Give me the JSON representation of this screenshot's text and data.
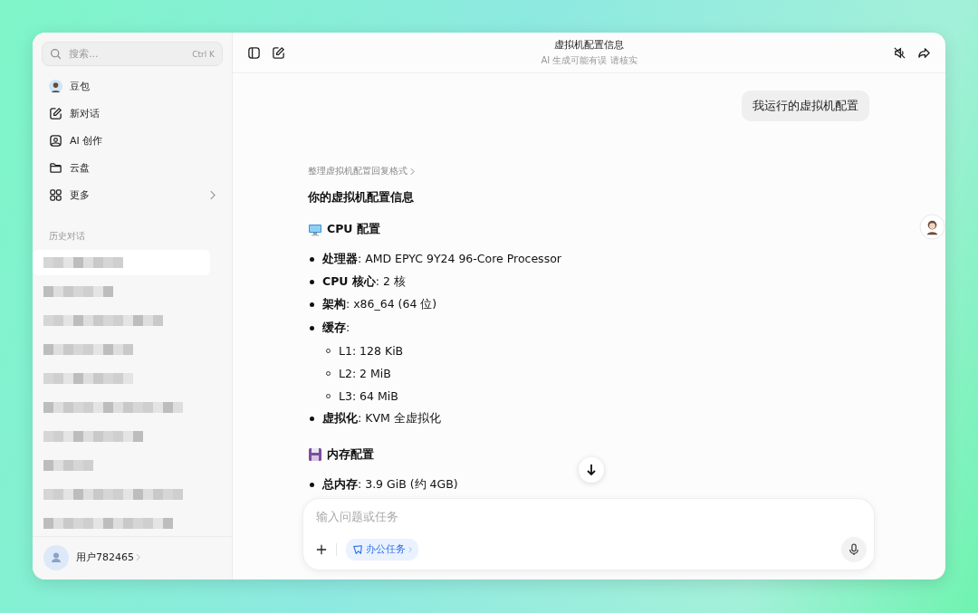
{
  "sidebar": {
    "search": {
      "placeholder": "搜索...",
      "shortcut": "Ctrl K"
    },
    "nav": [
      {
        "kind": "avatar",
        "label": "豆包"
      },
      {
        "kind": "new-chat",
        "label": "新对话"
      },
      {
        "kind": "image",
        "label": "AI 创作"
      },
      {
        "kind": "folder",
        "label": "云盘"
      },
      {
        "kind": "grid",
        "label": "更多"
      }
    ],
    "history_title": "历史对话",
    "history": [
      {
        "selected": true
      },
      {
        "selected": false
      },
      {
        "selected": false
      },
      {
        "selected": false
      },
      {
        "selected": false
      },
      {
        "selected": false
      },
      {
        "selected": false
      },
      {
        "selected": false
      },
      {
        "selected": false
      },
      {
        "selected": false
      }
    ],
    "user": {
      "name": "用户782465"
    }
  },
  "header": {
    "title": "虚拟机配置信息",
    "subtitle": "AI 生成可能有误 请核实"
  },
  "user_message": "我运行的虚拟机配置",
  "answer": {
    "thinking_link": "整理虚拟机配置回复格式",
    "title": "你的虚拟机配置信息",
    "sections": [
      {
        "heading": "CPU 配置",
        "items": [
          {
            "text": "**处理器**: AMD EPYC 9Y24 96-Core Processor"
          },
          {
            "text": "**CPU 核心**: 2 核"
          },
          {
            "text": "**架构**: x86_64 (64 位)"
          },
          {
            "text": "**缓存**:",
            "children": [
              {
                "text": "L1: 128 KiB"
              },
              {
                "text": "L2: 2 MiB"
              },
              {
                "text": "L3: 64 MiB"
              }
            ]
          },
          {
            "text": "**虚拟化**: KVM 全虚拟化"
          }
        ]
      },
      {
        "heading": "内存配置",
        "items": [
          {
            "text": "**总内存**: 3.9 GiB (约 4GB)"
          }
        ]
      }
    ]
  },
  "composer": {
    "placeholder": "输入问题或任务",
    "chip": "办公任务"
  }
}
